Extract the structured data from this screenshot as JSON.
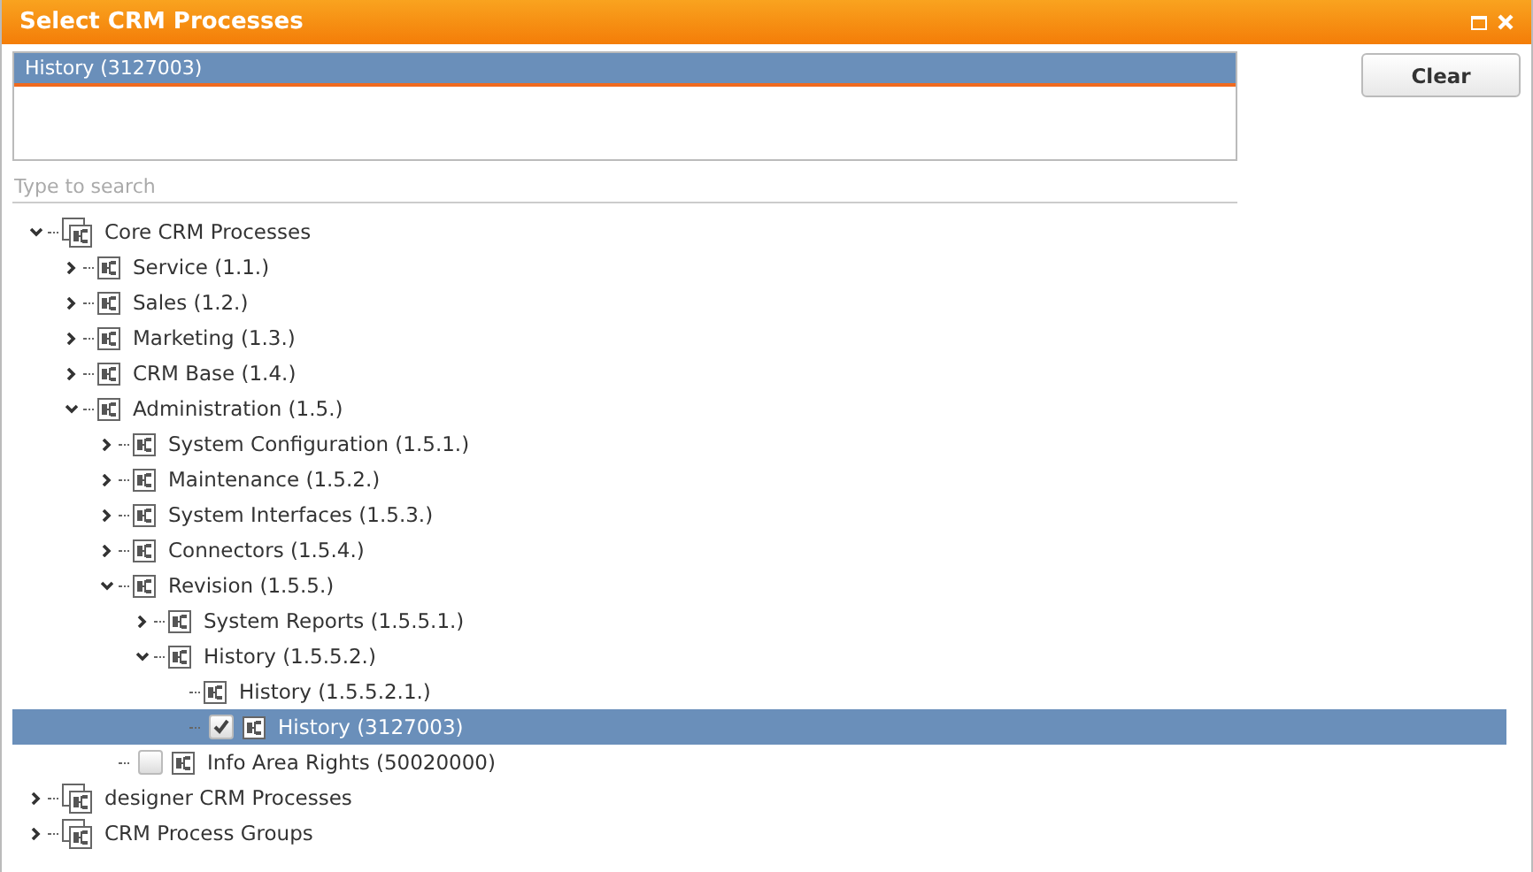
{
  "window": {
    "title": "Select CRM Processes"
  },
  "selected_list": [
    {
      "label": "History (3127003)",
      "selected": true
    }
  ],
  "clear_button": "Clear",
  "search": {
    "placeholder": "Type to search"
  },
  "tree": [
    {
      "kind": "group",
      "label": "Core CRM Processes",
      "expanded": true,
      "selected": false,
      "children": [
        {
          "kind": "process",
          "label": "Service (1.1.)",
          "expanded": false,
          "selected": false
        },
        {
          "kind": "process",
          "label": "Sales (1.2.)",
          "expanded": false,
          "selected": false
        },
        {
          "kind": "process",
          "label": "Marketing (1.3.)",
          "expanded": false,
          "selected": false
        },
        {
          "kind": "process",
          "label": "CRM Base (1.4.)",
          "expanded": false,
          "selected": false
        },
        {
          "kind": "process",
          "label": "Administration (1.5.)",
          "expanded": true,
          "selected": false,
          "children": [
            {
              "kind": "process",
              "label": "System Configuration (1.5.1.)",
              "expanded": false,
              "selected": false
            },
            {
              "kind": "process",
              "label": "Maintenance (1.5.2.)",
              "expanded": false,
              "selected": false
            },
            {
              "kind": "process",
              "label": "System Interfaces (1.5.3.)",
              "expanded": false,
              "selected": false
            },
            {
              "kind": "process",
              "label": "Connectors (1.5.4.)",
              "expanded": false,
              "selected": false
            },
            {
              "kind": "process",
              "label": "Revision (1.5.5.)",
              "expanded": true,
              "selected": false,
              "children": [
                {
                  "kind": "process",
                  "label": "System Reports (1.5.5.1.)",
                  "expanded": false,
                  "selected": false
                },
                {
                  "kind": "process",
                  "label": "History (1.5.5.2.)",
                  "expanded": true,
                  "selected": false,
                  "children": [
                    {
                      "kind": "leaf",
                      "label": "History (1.5.5.2.1.)",
                      "selected": false
                    },
                    {
                      "kind": "checkbox",
                      "label": "History (3127003)",
                      "checked": true,
                      "selected": true
                    }
                  ]
                }
              ]
            },
            {
              "kind": "checkbox",
              "label": "Info Area Rights (50020000)",
              "checked": false,
              "selected": false
            }
          ]
        }
      ]
    },
    {
      "kind": "group",
      "label": "designer CRM Processes",
      "expanded": false,
      "selected": false
    },
    {
      "kind": "group",
      "label": "CRM Process Groups",
      "expanded": false,
      "selected": false
    }
  ]
}
